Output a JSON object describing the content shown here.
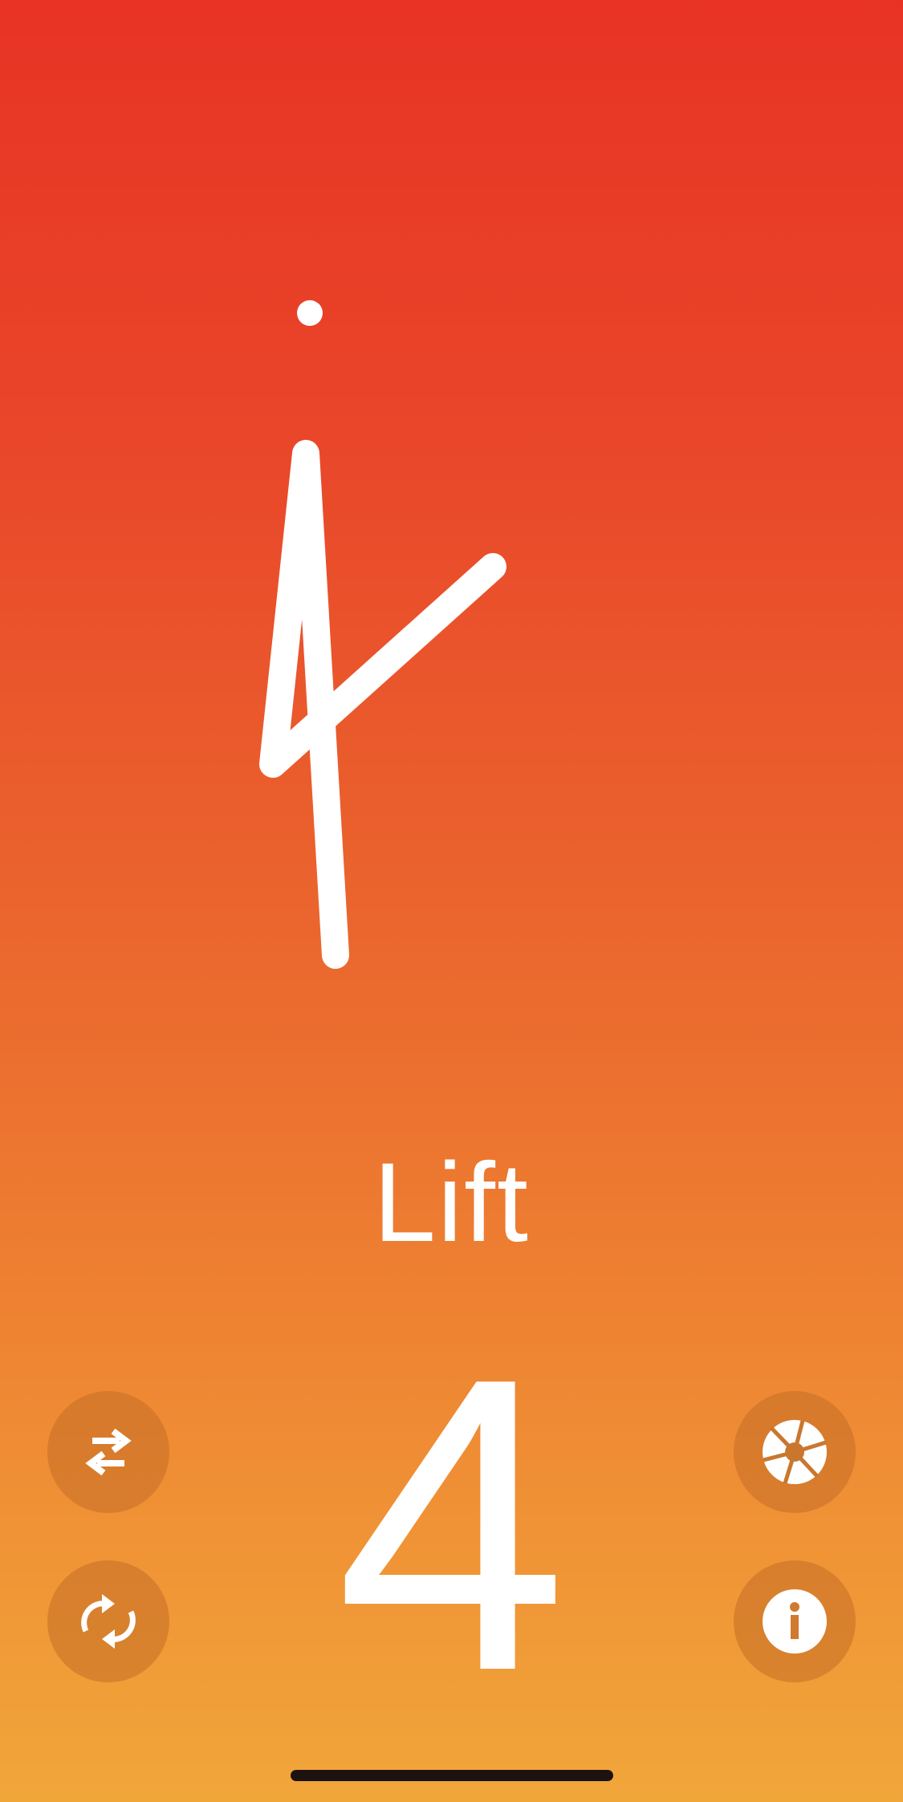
{
  "exercise": {
    "word": "Lift",
    "count": "4"
  },
  "colors": {
    "gradient_top": "#e83324",
    "gradient_bottom": "#f1a63a",
    "foreground": "#ffffff",
    "button_fill": "#c46e26"
  },
  "controls": {
    "left": [
      "swap-arrows-icon",
      "repeat-icon"
    ],
    "right": [
      "camera-shutter-icon",
      "info-icon"
    ]
  }
}
